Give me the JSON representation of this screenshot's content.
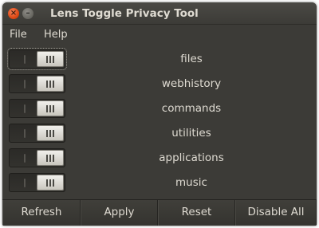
{
  "window": {
    "title": "Lens Toggle Privacy Tool",
    "close_glyph": "×",
    "minimize_glyph": "–"
  },
  "menu": {
    "items": [
      {
        "label": "File"
      },
      {
        "label": "Help"
      }
    ]
  },
  "lenses": [
    {
      "label": "files",
      "state": "off"
    },
    {
      "label": "webhistory",
      "state": "off"
    },
    {
      "label": "commands",
      "state": "off"
    },
    {
      "label": "utilities",
      "state": "off"
    },
    {
      "label": "applications",
      "state": "off"
    },
    {
      "label": "music",
      "state": "off"
    }
  ],
  "buttons": {
    "refresh": "Refresh",
    "apply": "Apply",
    "reset": "Reset",
    "disable_all": "Disable All"
  },
  "colors": {
    "window_bg": "#3c3b37",
    "text": "#dfdbd2",
    "close_button": "#dd4814"
  }
}
